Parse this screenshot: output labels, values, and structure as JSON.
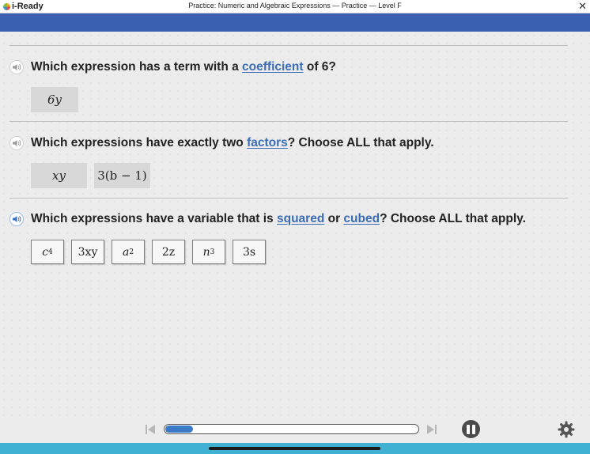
{
  "app": {
    "logo_text": "i-Ready",
    "window_title": "Practice: Numeric and Algebraic Expressions — Practice — Level F",
    "close_glyph": "✕"
  },
  "colors": {
    "header_blue": "#3a61b1",
    "link_blue": "#3b6cb6",
    "bottom_bar": "#41b1d3",
    "progress_fill": "#3a7ac9"
  },
  "questions": [
    {
      "parts": [
        "Which expression has a term with a ",
        "coefficient",
        " of 6?"
      ],
      "answers": [
        "6y"
      ]
    },
    {
      "parts": [
        "Which expressions have exactly two ",
        "factors",
        "? Choose ALL that apply."
      ],
      "answers": [
        "xy",
        "3(b − 1)"
      ]
    },
    {
      "parts": [
        "Which expressions have a variable that is ",
        "squared",
        " or ",
        "cubed",
        "? Choose ALL that apply."
      ],
      "choices": [
        {
          "base": "c",
          "exp": "4"
        },
        {
          "base": "3xy",
          "exp": ""
        },
        {
          "base": "a",
          "exp": "2"
        },
        {
          "base": "2z",
          "exp": ""
        },
        {
          "base": "n",
          "exp": "3"
        },
        {
          "base": "3s",
          "exp": ""
        }
      ]
    }
  ],
  "player": {
    "progress_fraction": 0.11,
    "icons": [
      "skip-back-icon",
      "pause-icon",
      "skip-forward-icon",
      "gear-icon",
      "speaker-icon"
    ]
  }
}
